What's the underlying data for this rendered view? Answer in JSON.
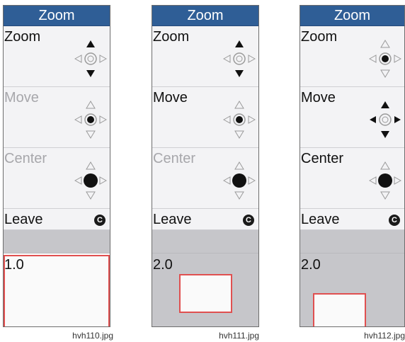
{
  "panels": [
    {
      "title": "Zoom",
      "items": [
        {
          "label": "Zoom",
          "active": true,
          "mode": "zoom-active"
        },
        {
          "label": "Move",
          "active": false,
          "mode": "small-dot"
        },
        {
          "label": "Center",
          "active": false,
          "mode": "big-dot"
        }
      ],
      "leave_label": "Leave",
      "leave_icon": "c-button-icon",
      "zoom_value": "1.0",
      "caption": "hvh110.jpg"
    },
    {
      "title": "Zoom",
      "items": [
        {
          "label": "Zoom",
          "active": true,
          "mode": "zoom-active"
        },
        {
          "label": "Move",
          "active": true,
          "mode": "small-dot"
        },
        {
          "label": "Center",
          "active": false,
          "mode": "big-dot"
        }
      ],
      "leave_label": "Leave",
      "leave_icon": "c-button-icon",
      "zoom_value": "2.0",
      "caption": "hvh111.jpg"
    },
    {
      "title": "Zoom",
      "items": [
        {
          "label": "Zoom",
          "active": true,
          "mode": "small-dot"
        },
        {
          "label": "Move",
          "active": true,
          "mode": "move-active"
        },
        {
          "label": "Center",
          "active": true,
          "mode": "big-dot"
        }
      ],
      "leave_label": "Leave",
      "leave_icon": "c-button-icon",
      "zoom_value": "2.0",
      "caption": "hvh112.jpg"
    }
  ],
  "colors": {
    "header": "#2f5e96",
    "zoom_frame": "#e05050",
    "dim_text": "#a7a7ab"
  }
}
